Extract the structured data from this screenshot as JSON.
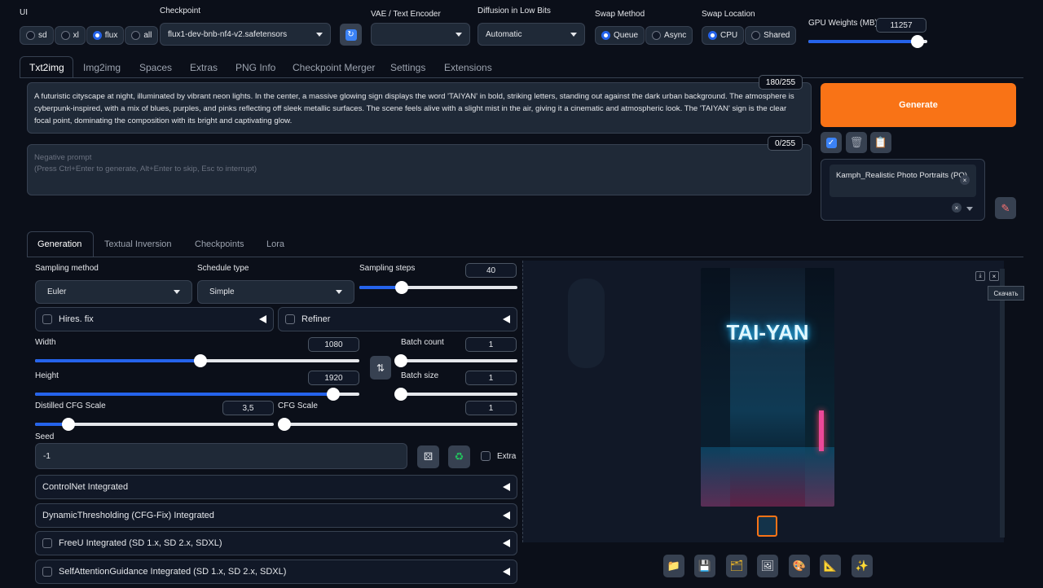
{
  "top": {
    "ui_label": "UI",
    "ui_options": [
      "sd",
      "xl",
      "flux",
      "all"
    ],
    "checkpoint_label": "Checkpoint",
    "checkpoint_value": "flux1-dev-bnb-nf4-v2.safetensors",
    "vae_label": "VAE / Text Encoder",
    "vae_value": "",
    "diffusion_label": "Diffusion in Low Bits",
    "diffusion_value": "Automatic",
    "swap_method_label": "Swap Method",
    "swap_method_options": [
      "Queue",
      "Async"
    ],
    "swap_location_label": "Swap Location",
    "swap_location_options": [
      "CPU",
      "Shared"
    ],
    "gpu_label": "GPU Weights (MB)",
    "gpu_value": "11257",
    "gpu_level": 0.92
  },
  "tabs": [
    "Txt2img",
    "Img2img",
    "Spaces",
    "Extras",
    "PNG Info",
    "Checkpoint Merger",
    "Settings",
    "Extensions"
  ],
  "prompt": {
    "text": "A futuristic cityscape at night, illuminated by vibrant neon lights. In the center, a massive glowing sign displays the word 'TAIYAN' in bold, striking letters, standing out against the dark urban background. The atmosphere is cyberpunk-inspired, with a mix of blues, purples, and pinks reflecting off sleek metallic surfaces. The scene feels alive with a slight mist in the air, giving it a cinematic and atmospheric look. The 'TAIYAN' sign is the clear focal point, dominating the composition with its bright and captivating glow.",
    "counter": "180/255",
    "neg_placeholder": "Negative prompt\n(Press Ctrl+Enter to generate, Alt+Enter to skip, Esc to interrupt)",
    "neg_counter": "0/255"
  },
  "generate_label": "Generate",
  "styles": {
    "chip": "Kamph_Realistic Photo Portraits (PO)"
  },
  "subtabs": [
    "Generation",
    "Textual Inversion",
    "Checkpoints",
    "Lora"
  ],
  "gen": {
    "sampling_method_label": "Sampling method",
    "sampling_method_value": "Euler",
    "schedule_label": "Schedule type",
    "schedule_value": "Simple",
    "steps_label": "Sampling steps",
    "steps_value": "40",
    "steps_level": 0.27,
    "hires_label": "Hires. fix",
    "refiner_label": "Refiner",
    "width_label": "Width",
    "width_value": "1080",
    "width_level": 0.51,
    "height_label": "Height",
    "height_value": "1920",
    "height_level": 0.92,
    "batch_count_label": "Batch count",
    "batch_count_value": "1",
    "batch_count_level": 0.0,
    "batch_size_label": "Batch size",
    "batch_size_value": "1",
    "batch_size_level": 0.0,
    "distilled_label": "Distilled CFG Scale",
    "distilled_value": "3,5",
    "distilled_level": 0.14,
    "cfg_label": "CFG Scale",
    "cfg_value": "1",
    "cfg_level": 0.0,
    "seed_label": "Seed",
    "seed_value": "-1",
    "extra_label": "Extra"
  },
  "accordions": [
    {
      "label": "ControlNet Integrated",
      "check": false
    },
    {
      "label": "DynamicThresholding (CFG-Fix) Integrated",
      "check": false
    },
    {
      "label": "FreeU Integrated (SD 1.x, SD 2.x, SDXL)",
      "check": true
    },
    {
      "label": "SelfAttentionGuidance Integrated (SD 1.x, SD 2.x, SDXL)",
      "check": true
    }
  ],
  "output": {
    "image_text": "TAI-YAN",
    "tooltip": "Скачать"
  },
  "colors": {
    "accent": "#2563eb",
    "generate": "#f97316",
    "bg": "#0b0f19"
  },
  "icons": [
    "refresh-icon",
    "swap-icon",
    "dice-icon",
    "recycle-icon",
    "folder-icon",
    "save-icon",
    "zip-icon",
    "image-icon",
    "palette-icon",
    "ruler-icon",
    "sparkle-icon",
    "pencil-icon",
    "trash-icon",
    "clipboard-icon",
    "checkmark-icon",
    "download-icon",
    "close-icon"
  ]
}
